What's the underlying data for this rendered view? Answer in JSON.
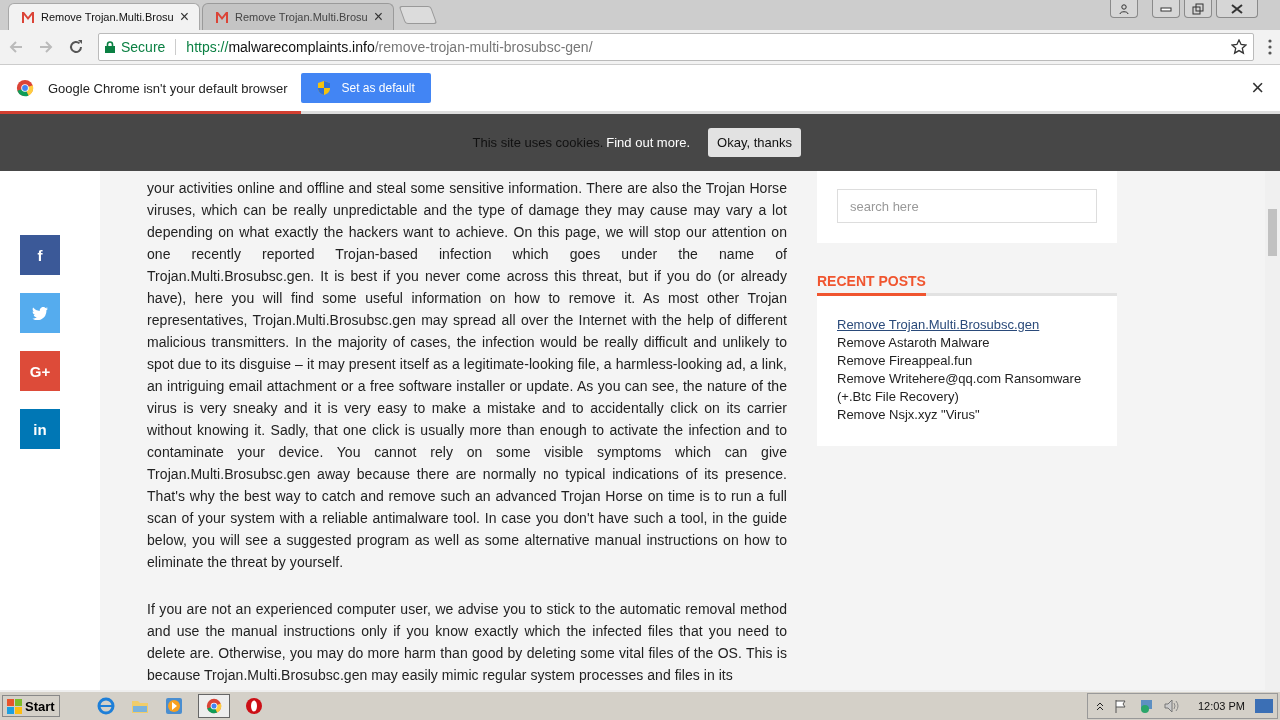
{
  "tabs": [
    {
      "title": "Remove Trojan.Multi.Brosu",
      "close": "×",
      "selected": true
    },
    {
      "title": "Remove Trojan.Multi.Brosu",
      "close": "×",
      "selected": false
    }
  ],
  "address_bar": {
    "secure_label": "Secure",
    "scheme": "https://",
    "host": "malwarecomplaints.info",
    "path": "/remove-trojan-multi-brosubsc-gen/"
  },
  "infobar": {
    "message": "Google Chrome isn't your default browser",
    "button": "Set as default",
    "close": "×"
  },
  "loading_progress": {
    "level": 0.235
  },
  "cookie_bar": {
    "message": "This site uses cookies.",
    "link": "Find out more.",
    "button": "Okay, thanks"
  },
  "share_buttons": [
    {
      "kind": "text",
      "label": "f",
      "color": "#3b5998"
    },
    {
      "kind": "bird",
      "color": "#55acee"
    },
    {
      "kind": "text",
      "label": "G+",
      "color": "#dd4b39"
    },
    {
      "kind": "text",
      "label": "in",
      "color": "#0077b5"
    }
  ],
  "article": {
    "paragraphs": [
      "your activities online and offline and steal some sensitive information. There are also the Trojan Horse viruses, which can be really unpredictable and the type of damage they may cause may vary a lot depending on what exactly the hackers want to achieve. On this page, we will stop our attention on one recently reported Trojan-based infection which goes under the name of Trojan.Multi.Brosubsc.gen. It is best if you never come across this threat, but if you do (or already have), here you will find some useful information on how to remove it. As most other Trojan representatives, Trojan.Multi.Brosubsc.gen may spread all over the Internet with the help of different malicious transmitters. In the majority of cases, the infection would be really difficult and unlikely to spot due to its disguise – it may present itself as a legitimate-looking file, a harmless-looking ad, a link, an intriguing email attachment or a free software installer or update. As you can see, the nature of the virus is very sneaky and it is very easy to make a mistake and to accidentally click on its carrier without knowing it. Sadly, that one click is usually more than enough to activate the infection and to contaminate your device. You cannot rely on some visible symptoms which can give Trojan.Multi.Brosubsc.gen away because there are normally no typical indications of its presence. That's why the best way to catch and remove such an advanced Trojan Horse on time is to run a full scan of your system with a reliable antimalware tool. In case you don't have such a tool, in the guide below, you will see a suggested program as well as some alternative manual instructions on how to eliminate the threat by yourself.",
      "If you are not an experienced computer user, we advise you to stick to the automatic removal method and use the manual instructions only if you know exactly which the infected files that you need to delete are. Otherwise, you may do more harm than good by deleting some vital files of the OS. This is because Trojan.Multi.Brosubsc.gen may easily mimic regular system processes and files in its"
    ]
  },
  "sidebar": {
    "search": {
      "placeholder": "search here"
    },
    "recent_posts": {
      "title": "RECENT POSTS",
      "items": [
        {
          "text": "Remove Trojan.Multi.Brosubsc.gen",
          "selected": true
        },
        {
          "text": "Remove Astaroth Malware",
          "selected": false
        },
        {
          "text": "Remove Fireappeal.fun",
          "selected": false
        },
        {
          "text": "Remove Writehere@qq.com Ransomware (+.Btc File Recovery)",
          "selected": false
        },
        {
          "text": "Remove Nsjx.xyz \"Virus\"",
          "selected": false
        }
      ]
    }
  },
  "taskbar": {
    "start": "Start",
    "clock": "12:03 PM"
  }
}
